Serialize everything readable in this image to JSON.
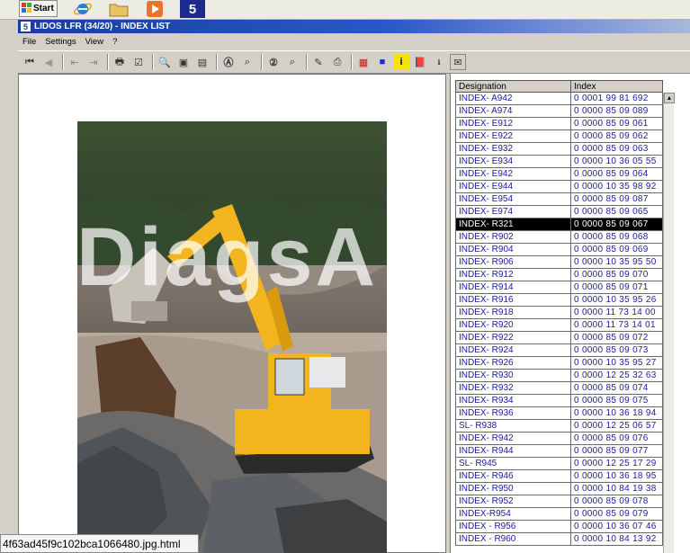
{
  "taskbar": {
    "start_label": "Start"
  },
  "window": {
    "title": "LIDOS LFR (34/20) - INDEX LIST"
  },
  "menu": [
    "File",
    "Settings",
    "View",
    "?"
  ],
  "watermark": "DiagsA",
  "table": {
    "headers": [
      "Designation",
      "Index"
    ],
    "rows": [
      {
        "designation": "INDEX- A942",
        "index": "0 0001 99 81 692"
      },
      {
        "designation": "INDEX- A974",
        "index": "0 0000 85 09 089"
      },
      {
        "designation": "INDEX- E912",
        "index": "0 0000 85 09 061"
      },
      {
        "designation": "INDEX- E922",
        "index": "0 0000 85 09 062"
      },
      {
        "designation": "INDEX- E932",
        "index": "0 0000 85 09 063"
      },
      {
        "designation": "INDEX- E934",
        "index": "0 0000 10 36 05 55"
      },
      {
        "designation": "INDEX- E942",
        "index": "0 0000 85 09 064"
      },
      {
        "designation": "INDEX- E944",
        "index": "0 0000 10 35 98 92"
      },
      {
        "designation": "INDEX- E954",
        "index": "0 0000 85 09 087"
      },
      {
        "designation": "INDEX- E974",
        "index": "0 0000 85 09 065"
      },
      {
        "designation": "INDEX- R321",
        "index": "0 0000 85 09 067"
      },
      {
        "designation": "INDEX- R902",
        "index": "0 0000 85 09 068"
      },
      {
        "designation": "INDEX- R904",
        "index": "0 0000 85 09 069"
      },
      {
        "designation": "INDEX- R906",
        "index": "0 0000 10 35 95 50"
      },
      {
        "designation": "INDEX- R912",
        "index": "0 0000 85 09 070"
      },
      {
        "designation": "INDEX- R914",
        "index": "0 0000 85 09 071"
      },
      {
        "designation": "INDEX- R916",
        "index": "0 0000 10 35 95 26"
      },
      {
        "designation": "INDEX- R918",
        "index": "0 0000 11 73 14 00"
      },
      {
        "designation": "INDEX- R920",
        "index": "0 0000 11 73 14 01"
      },
      {
        "designation": "INDEX- R922",
        "index": "0 0000 85 09 072"
      },
      {
        "designation": "INDEX- R924",
        "index": "0 0000 85 09 073"
      },
      {
        "designation": "INDEX- R926",
        "index": "0 0000 10 35 95 27"
      },
      {
        "designation": "INDEX- R930",
        "index": "0 0000 12 25 32 63"
      },
      {
        "designation": "INDEX- R932",
        "index": "0 0000 85 09 074"
      },
      {
        "designation": "INDEX- R934",
        "index": "0 0000 85 09 075"
      },
      {
        "designation": "INDEX- R936",
        "index": "0 0000 10 36 18 94"
      },
      {
        "designation": "SL- R938",
        "index": "0 0000 12 25 06 57"
      },
      {
        "designation": "INDEX- R942",
        "index": "0 0000 85 09 076"
      },
      {
        "designation": "INDEX- R944",
        "index": "0 0000 85 09 077"
      },
      {
        "designation": "SL- R945",
        "index": "0 0000 12 25 17 29"
      },
      {
        "designation": "INDEX- R946",
        "index": "0 0000 10 36 18 95"
      },
      {
        "designation": "INDEX- R950",
        "index": "0 0000 10 84 19 38"
      },
      {
        "designation": "INDEX- R952",
        "index": "0 0000 85 09 078"
      },
      {
        "designation": "INDEX-R954",
        "index": "0 0000 85 09 079"
      },
      {
        "designation": "INDEX - R956",
        "index": "0 0000 10 36 07 46"
      },
      {
        "designation": "INDEX - R960",
        "index": "0 0000 10 84 13 92"
      }
    ],
    "selected_row": 10
  },
  "status_bar": {
    "filename": "4f63ad45f9c102bca1066480.jpg.html"
  },
  "colors": {
    "title_bar": "#1a3da0",
    "link_text": "#1a1aa8",
    "selection": "#000000",
    "machine_yellow": "#f3b51d"
  }
}
